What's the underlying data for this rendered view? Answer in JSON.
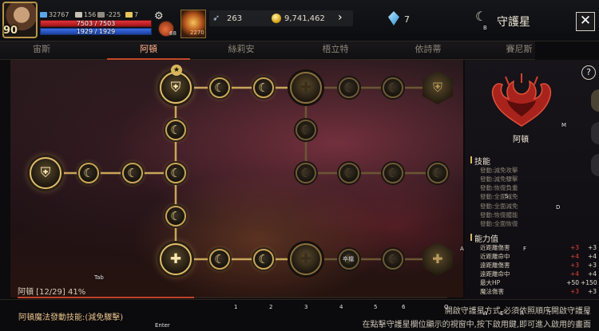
{
  "player": {
    "level": "90",
    "stats": [
      "32767",
      "156",
      "-225",
      "7"
    ],
    "hp_text": "7503 / 7503",
    "hp_fraction": 1.0,
    "mp_text": "1929 / 1929",
    "mp_fraction": 1.0,
    "potion_count": "68",
    "skill_count": "2270"
  },
  "currency": {
    "feathers": "263",
    "gold": "9,741,462",
    "gems": "7"
  },
  "header": {
    "title": "守護星",
    "close_glyph": "✕"
  },
  "tabs": [
    {
      "label": "宙斯",
      "active": false
    },
    {
      "label": "阿頓",
      "active": true
    },
    {
      "label": "絲莉安",
      "active": false
    },
    {
      "label": "梧立特",
      "active": false
    },
    {
      "label": "依詩蒂",
      "active": false
    },
    {
      "label": "賽尼斯",
      "active": false
    }
  ],
  "tree": {
    "progress_text": "阿頓 [12/29] 41%",
    "progress_fraction": 0.41,
    "node_label": "卒檔",
    "glyphs": {
      "small": "☾",
      "big": "⛨",
      "cross": "✚"
    }
  },
  "info": {
    "guardian_name": "阿頓",
    "help_glyph": "?",
    "skills_title": "技能",
    "skills": [
      "發動:減免攻擊",
      "發動:減免驟擊",
      "發動:恢復負重",
      "發動:全面減免",
      "發動:全面減免",
      "發動:恢復體能",
      "發動:全面恢復"
    ],
    "stats_title": "能力值",
    "stats": [
      {
        "name": "近距離傷害",
        "v1": "+3",
        "v1_red": true,
        "v2": "+3"
      },
      {
        "name": "近距離命中",
        "v1": "+4",
        "v1_red": true,
        "v2": "+4"
      },
      {
        "name": "遠距離傷害",
        "v1": "+3",
        "v1_red": true,
        "v2": "+3"
      },
      {
        "name": "遠距離命中",
        "v1": "+4",
        "v1_red": true,
        "v2": "+4"
      },
      {
        "name": "最大HP",
        "v1": "+50",
        "v1_red": false,
        "v2": "+150"
      },
      {
        "name": "魔法傷害",
        "v1": "+3",
        "v1_red": true,
        "v2": "+3"
      }
    ]
  },
  "bottom": {
    "skill_desc": "阿頓魔法發動技能:(減免驟擊)",
    "hint_line1": "開啟守護星方式,必須依照順序開啟守護星",
    "hint_line2": "在點擊守護星欄位顯示的視窗中,按下啟用鍵,即可進入啟用的畫面"
  },
  "key_hints": {
    "b": "B",
    "m": "M",
    "s": "S",
    "d": "D",
    "a": "A",
    "f": "F",
    "tab": "Tab",
    "enter": "Enter",
    "nums": [
      "1",
      "2",
      "3",
      "4",
      "5",
      "6"
    ],
    "row": [
      "Q",
      "W",
      "E",
      "R",
      "T",
      "Y"
    ]
  }
}
